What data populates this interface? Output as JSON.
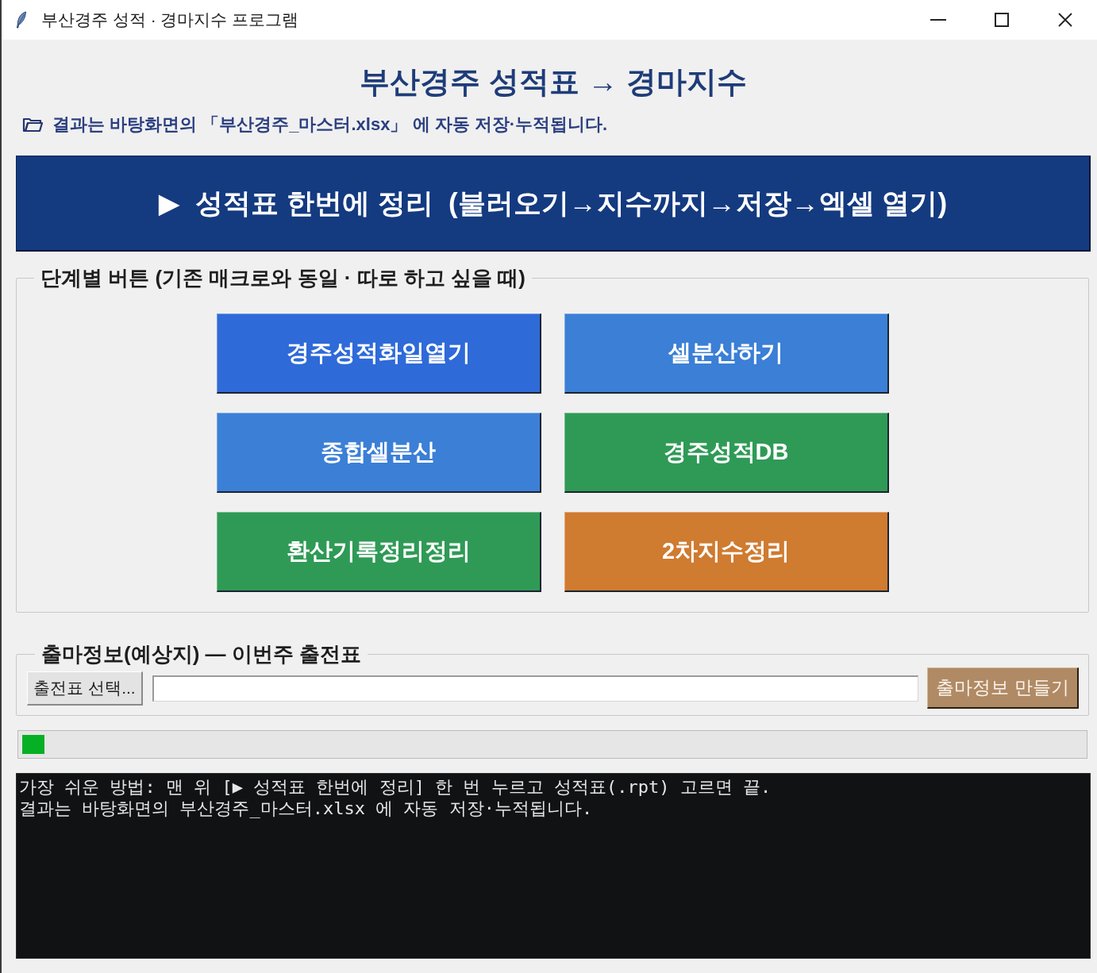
{
  "window": {
    "title": "부산경주 성적 · 경마지수 프로그램"
  },
  "header": {
    "title": "부산경주 성적표 → 경마지수",
    "note": "결과는 바탕화면의 「부산경주_마스터.xlsx」 에 자동 저장·누적됩니다."
  },
  "main_button": {
    "label": "▶  성적표 한번에 정리  (불러오기→지수까지→저장→엑셀 열기)"
  },
  "step_panel": {
    "title": "단계별 버튼 (기존 매크로와 동일 · 따로 하고 싶을 때)",
    "buttons": [
      {
        "label": "경주성적화일열기",
        "color": "#2e6ad8"
      },
      {
        "label": "셀분산하기",
        "color": "#3b7fd6"
      },
      {
        "label": "종합셀분산",
        "color": "#3b7fd6"
      },
      {
        "label": "경주성적DB",
        "color": "#2f9a56"
      },
      {
        "label": "환산기록정리정리",
        "color": "#2f9a56"
      },
      {
        "label": "2차지수정리",
        "color": "#cf7b30"
      }
    ]
  },
  "entry_panel": {
    "title": "출마정보(예상지) — 이번주 출전표",
    "browse_button": "출전표 선택...",
    "make_button": "출마정보 만들기"
  },
  "progress": {
    "level": 0.021
  },
  "log": {
    "lines": [
      "가장 쉬운 방법: 맨 위 [▶ 성적표 한번에 정리] 한 번 누르고 성적표(.rpt) 고르면 끝.",
      "결과는 바탕화면의 부산경주_마스터.xlsx 에 자동 저장·누적됩니다."
    ]
  }
}
